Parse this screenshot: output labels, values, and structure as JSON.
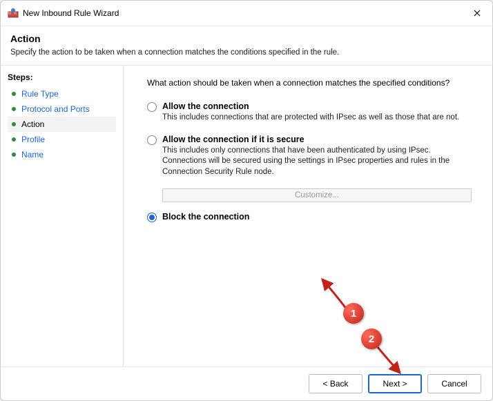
{
  "window": {
    "title": "New Inbound Rule Wizard"
  },
  "header": {
    "title": "Action",
    "subtitle": "Specify the action to be taken when a connection matches the conditions specified in the rule."
  },
  "sidebar": {
    "label": "Steps:",
    "items": [
      {
        "label": "Rule Type",
        "current": false
      },
      {
        "label": "Protocol and Ports",
        "current": false
      },
      {
        "label": "Action",
        "current": true
      },
      {
        "label": "Profile",
        "current": false
      },
      {
        "label": "Name",
        "current": false
      }
    ]
  },
  "main": {
    "prompt": "What action should be taken when a connection matches the specified conditions?",
    "options": [
      {
        "id": "allow",
        "title": "Allow the connection",
        "desc": "This includes connections that are protected with IPsec as well as those that are not.",
        "checked": false
      },
      {
        "id": "allow-secure",
        "title": "Allow the connection if it is secure",
        "desc": "This includes only connections that have been authenticated by using IPsec.  Connections will be secured using the settings in IPsec properties and rules in the Connection Security Rule node.",
        "checked": false
      },
      {
        "id": "block",
        "title": "Block the connection",
        "desc": "",
        "checked": true
      }
    ],
    "customize_label": "Customize..."
  },
  "buttons": {
    "back": "< Back",
    "next": "Next >",
    "cancel": "Cancel"
  },
  "annotations": {
    "n1": "1",
    "n2": "2"
  }
}
